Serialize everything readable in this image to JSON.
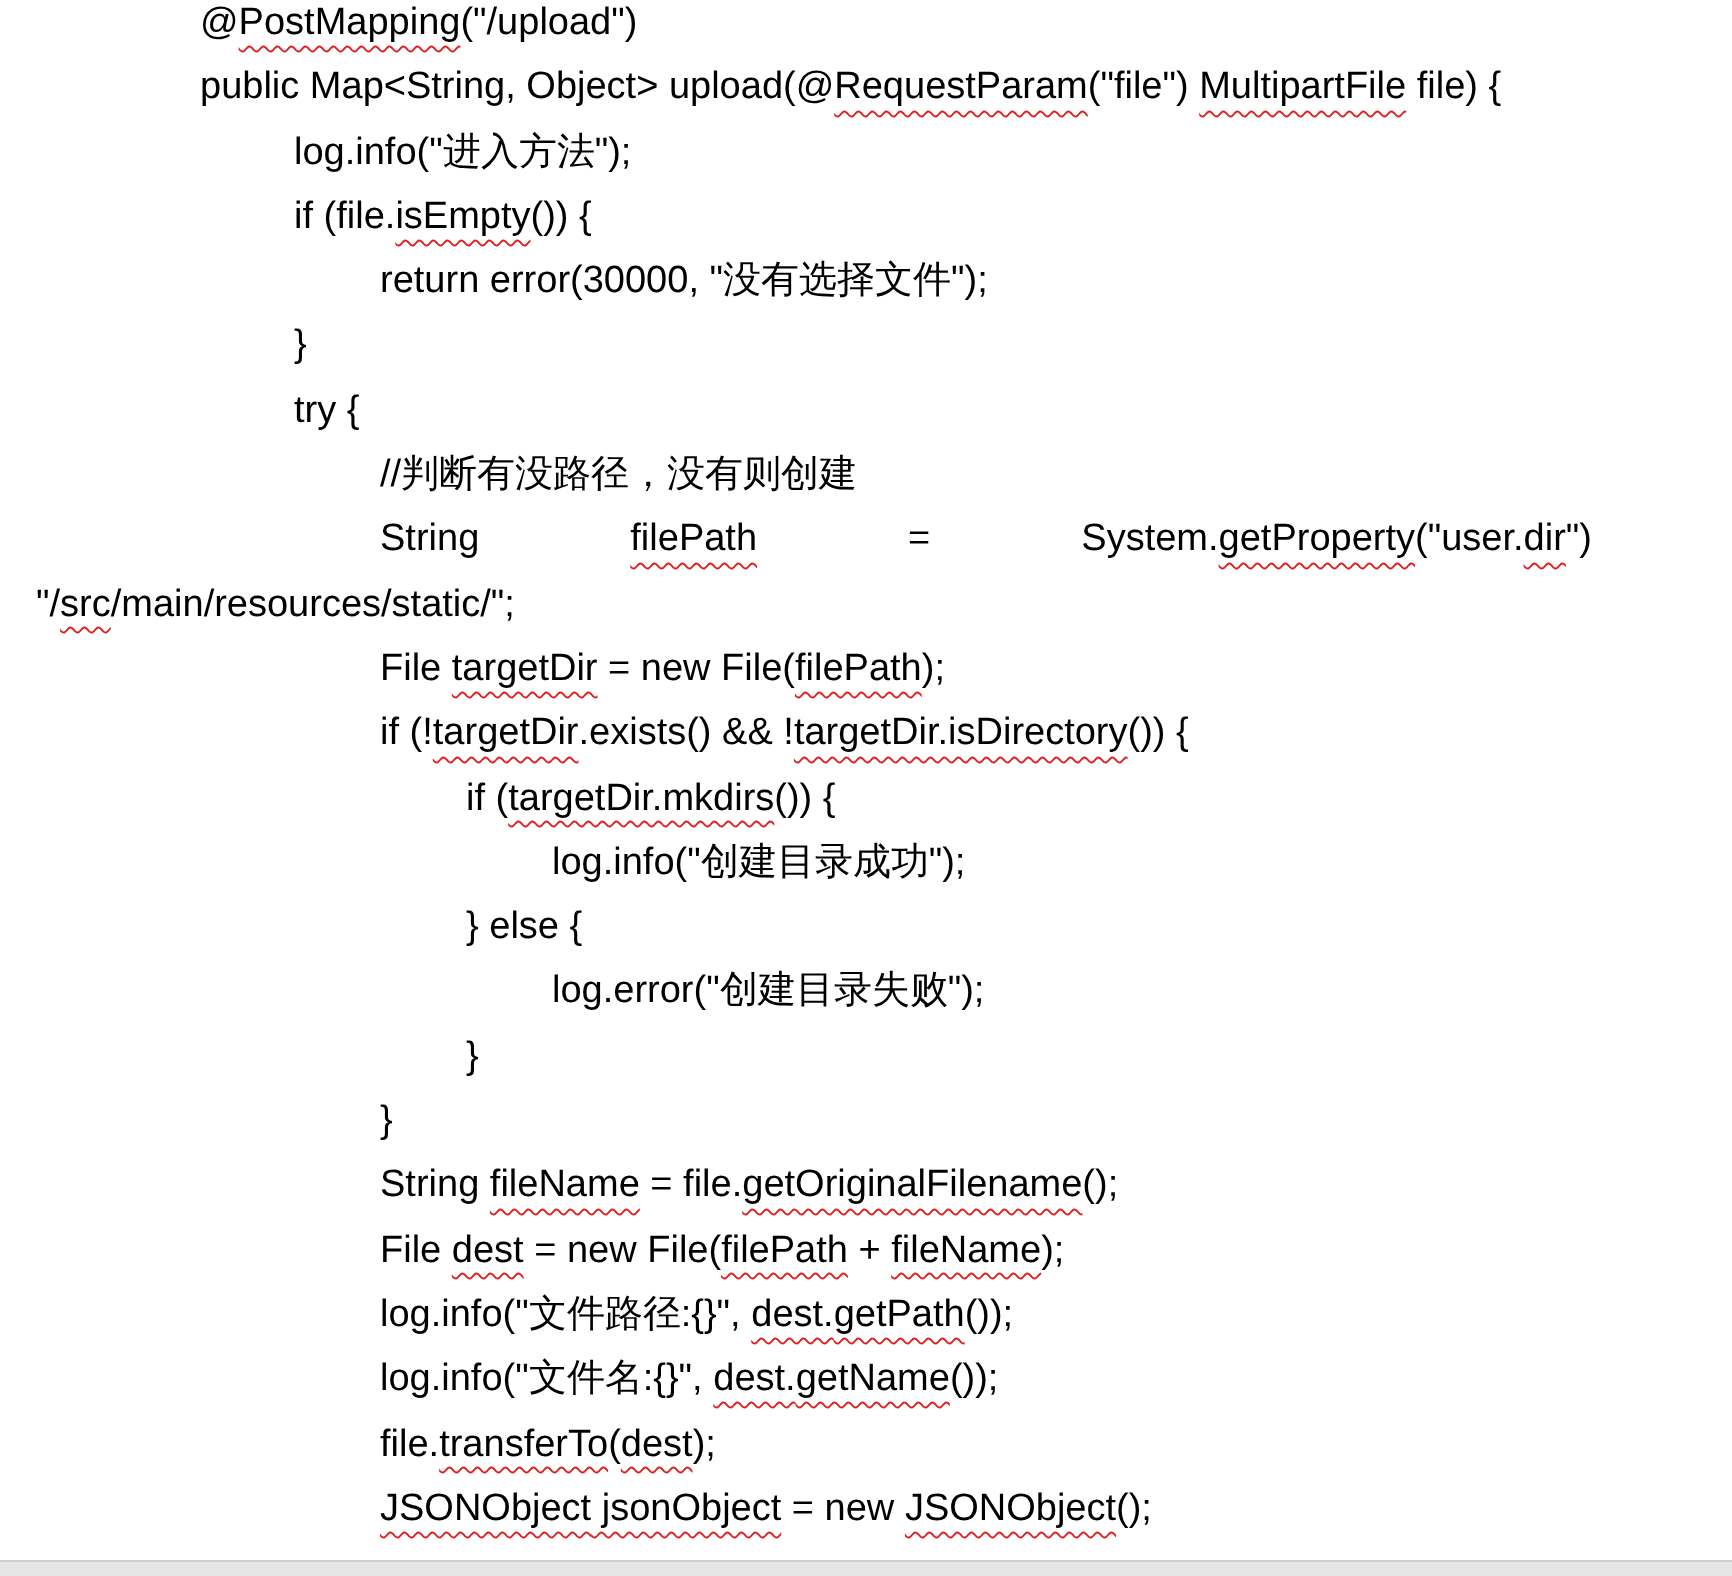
{
  "code_lines": [
    {
      "parts": [
        {
          "text": "@",
          "misspelled": false
        },
        {
          "text": "PostMapping",
          "misspelled": true
        },
        {
          "text": "(\"/upload\")",
          "misspelled": false
        }
      ]
    },
    {
      "parts": [
        {
          "text": "public Map<String, Object> upload(@",
          "misspelled": false
        },
        {
          "text": "RequestParam",
          "misspelled": true
        },
        {
          "text": "(\"file\") ",
          "misspelled": false
        },
        {
          "text": "MultipartFile",
          "misspelled": true
        },
        {
          "text": " file) {",
          "misspelled": false
        }
      ],
      "children": [
        {
          "parts": [
            {
              "text": "log.info(\"进入方法\");",
              "misspelled": false
            }
          ]
        },
        {
          "parts": [
            {
              "text": "if (file.",
              "misspelled": false
            },
            {
              "text": "isEmpty",
              "misspelled": true
            },
            {
              "text": "()) {",
              "misspelled": false
            }
          ],
          "children": [
            {
              "parts": [
                {
                  "text": "return error(30000, \"没有选择文件\");",
                  "misspelled": false
                }
              ]
            }
          ]
        },
        {
          "parts": [
            {
              "text": "}",
              "misspelled": false
            }
          ]
        },
        {
          "parts": [
            {
              "text": "try {",
              "misspelled": false
            }
          ],
          "children": [
            {
              "parts": [
                {
                  "text": "//判断有没路径，没有则创建",
                  "misspelled": false
                }
              ]
            },
            {
              "parts": [
                {
                  "text": "String ",
                  "misspelled": false
                },
                {
                  "text": "filePath",
                  "misspelled": true
                },
                {
                  "text": " = System.",
                  "misspelled": false
                },
                {
                  "text": "getProperty",
                  "misspelled": true
                },
                {
                  "text": "(\"user.",
                  "misspelled": false
                },
                {
                  "text": "dir",
                  "misspelled": true
                },
                {
                  "text": "\")",
                  "misspelled": false
                }
              ],
              "continuation": {
                "parts": [
                  {
                    "text": "\"/",
                    "misspelled": false
                  },
                  {
                    "text": "src",
                    "misspelled": true
                  },
                  {
                    "text": "/main/resources/static/\";",
                    "misspelled": false
                  }
                ]
              }
            },
            {
              "parts": [
                {
                  "text": "File ",
                  "misspelled": false
                },
                {
                  "text": "targetDir",
                  "misspelled": true
                },
                {
                  "text": " = new File(",
                  "misspelled": false
                },
                {
                  "text": "filePath",
                  "misspelled": true
                },
                {
                  "text": ");",
                  "misspelled": false
                }
              ]
            },
            {
              "parts": [
                {
                  "text": "if (!",
                  "misspelled": false
                },
                {
                  "text": "targetDir",
                  "misspelled": true
                },
                {
                  "text": ".exists() && !",
                  "misspelled": false
                },
                {
                  "text": "targetDir.",
                  "misspelled": true
                },
                {
                  "text": "isDirectory",
                  "misspelled": true
                },
                {
                  "text": "()) {",
                  "misspelled": false
                }
              ],
              "children": [
                {
                  "parts": [
                    {
                      "text": "if (",
                      "misspelled": false
                    },
                    {
                      "text": "targetDir.",
                      "misspelled": true
                    },
                    {
                      "text": "mkdirs",
                      "misspelled": true
                    },
                    {
                      "text": "()) {",
                      "misspelled": false
                    }
                  ],
                  "children": [
                    {
                      "parts": [
                        {
                          "text": "log.info(\"创建目录成功\");",
                          "misspelled": false
                        }
                      ]
                    }
                  ]
                },
                {
                  "parts": [
                    {
                      "text": "} else {",
                      "misspelled": false
                    }
                  ],
                  "children": [
                    {
                      "parts": [
                        {
                          "text": "log.error(\"创建目录失败\");",
                          "misspelled": false
                        }
                      ]
                    }
                  ]
                },
                {
                  "parts": [
                    {
                      "text": "}",
                      "misspelled": false
                    }
                  ]
                }
              ]
            },
            {
              "parts": [
                {
                  "text": "}",
                  "misspelled": false
                }
              ]
            },
            {
              "parts": [
                {
                  "text": "String ",
                  "misspelled": false
                },
                {
                  "text": "fileName",
                  "misspelled": true
                },
                {
                  "text": " = file.",
                  "misspelled": false
                },
                {
                  "text": "getOriginalFilename",
                  "misspelled": true
                },
                {
                  "text": "();",
                  "misspelled": false
                }
              ]
            },
            {
              "parts": [
                {
                  "text": "File ",
                  "misspelled": false
                },
                {
                  "text": "dest",
                  "misspelled": true
                },
                {
                  "text": " = new File(",
                  "misspelled": false
                },
                {
                  "text": "filePath",
                  "misspelled": true
                },
                {
                  "text": " + ",
                  "misspelled": false
                },
                {
                  "text": "fileName",
                  "misspelled": true
                },
                {
                  "text": ");",
                  "misspelled": false
                }
              ]
            },
            {
              "parts": [
                {
                  "text": "log.info(\"文件路径:{}\", ",
                  "misspelled": false
                },
                {
                  "text": "dest.",
                  "misspelled": true
                },
                {
                  "text": "getPath",
                  "misspelled": true
                },
                {
                  "text": "());",
                  "misspelled": false
                }
              ]
            },
            {
              "parts": [
                {
                  "text": "log.info(\"文件名:{}\", ",
                  "misspelled": false
                },
                {
                  "text": "dest.",
                  "misspelled": true
                },
                {
                  "text": "getName",
                  "misspelled": true
                },
                {
                  "text": "());",
                  "misspelled": false
                }
              ]
            },
            {
              "parts": [
                {
                  "text": "file.",
                  "misspelled": false
                },
                {
                  "text": "transferTo",
                  "misspelled": true
                },
                {
                  "text": "(",
                  "misspelled": false
                },
                {
                  "text": "dest",
                  "misspelled": true
                },
                {
                  "text": ");",
                  "misspelled": false
                }
              ]
            },
            {
              "parts": [
                {
                  "text": "JSONObject",
                  "misspelled": true
                },
                {
                  "text": " jsonObject",
                  "misspelled": true
                },
                {
                  "text": " = new ",
                  "misspelled": false
                },
                {
                  "text": "JSONObject",
                  "misspelled": true
                },
                {
                  "text": "();",
                  "misspelled": false
                }
              ]
            }
          ]
        }
      ]
    }
  ]
}
